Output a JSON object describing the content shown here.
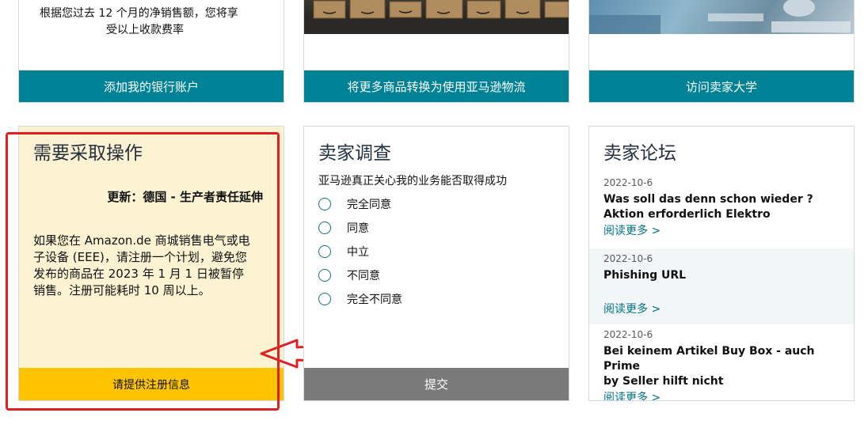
{
  "card_payments": {
    "desc_line1": "根据您过去 12 个月的净销售额，您将享",
    "desc_line2": "受以上收款费率",
    "button": "添加我的银行账户"
  },
  "card_fba": {
    "button": "将更多商品转换为使用亚马逊物流"
  },
  "card_university": {
    "button": "访问卖家大学"
  },
  "action_card": {
    "title": "需要采取操作",
    "subtitle": "更新：德国 - 生产者责任延伸",
    "body_line1": "如果您在 Amazon.de 商城销售电气或电",
    "body_line2": "子设备 (EEE)，请注册一个计划，避免您",
    "body_line3": "发布的商品在 2023 年 1 月 1 日被暂停",
    "body_line4": "销售。注册可能耗时 10 周以上。",
    "button": "请提供注册信息",
    "colors": {
      "background": "#fdf3d2",
      "button": "#ffc400",
      "highlight_border": "#e02020"
    }
  },
  "survey_card": {
    "title": "卖家调查",
    "question": "亚马逊真正关心我的业务能否取得成功",
    "options": [
      "完全同意",
      "同意",
      "中立",
      "不同意",
      "完全不同意"
    ],
    "submit": "提交"
  },
  "forum_card": {
    "title": "卖家论坛",
    "posts": [
      {
        "date": "2022-10-6",
        "title_line1": "Was soll das denn schon wieder ?",
        "title_line2": "Aktion erforderlich Elektro",
        "link": "阅读更多 >"
      },
      {
        "date": "2022-10-6",
        "title_line1": "Phishing URL",
        "title_line2": "",
        "link": "阅读更多 >"
      },
      {
        "date": "2022-10-6",
        "title_line1": "Bei keinem Artikel Buy Box - auch Prime",
        "title_line2": "by Seller hilft nicht",
        "link": "阅读更多 >"
      }
    ]
  }
}
